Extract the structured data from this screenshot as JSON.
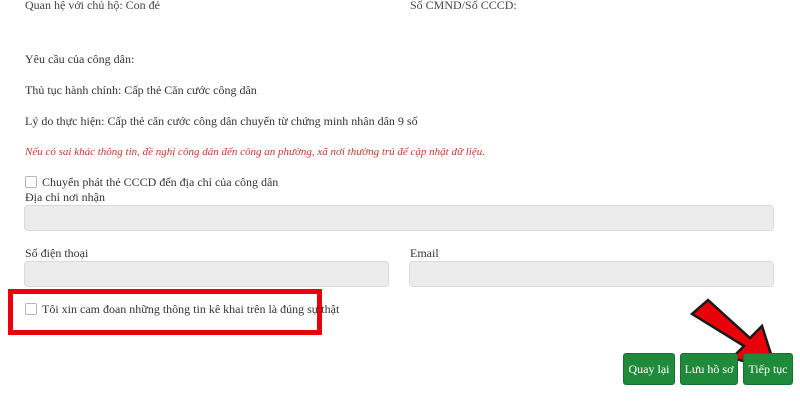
{
  "top": {
    "relation_label": "Quan hệ với chủ hộ: Con đẻ",
    "id_label": "Số CMND/Số CCCD:"
  },
  "request": {
    "heading": "Yêu cầu của công dân:",
    "procedure": "Thủ tục hành chính: Cấp thẻ Căn cước công dân",
    "reason": "Lý do thực hiện: Cấp thẻ căn cước công dân chuyển từ chứng minh nhân dân 9 số",
    "warning": "Nếu có sai khác thông tin, đề nghị công dân đến công an phường, xã nơi thường trú để cập nhật dữ liệu."
  },
  "delivery": {
    "checkbox_label": "Chuyển phát thẻ CCCD đến địa chỉ của công dân",
    "checked": false,
    "address_label": "Địa chỉ nơi nhận",
    "address_value": ""
  },
  "contact": {
    "phone_label": "Số điện thoại",
    "phone_value": "",
    "email_label": "Email",
    "email_value": ""
  },
  "commitment": {
    "checkbox_label": "Tôi xin cam đoan những thông tin kê khai trên là đúng sự thật",
    "checked": false
  },
  "buttons": {
    "back": "Quay lại",
    "save": "Lưu hồ sơ",
    "next": "Tiếp tục"
  },
  "colors": {
    "button_green": "#1f8a3a",
    "warning_red": "#c0392b",
    "highlight_red": "#e8000b"
  },
  "icons": {
    "arrow": "red-pointer-arrow-icon"
  }
}
